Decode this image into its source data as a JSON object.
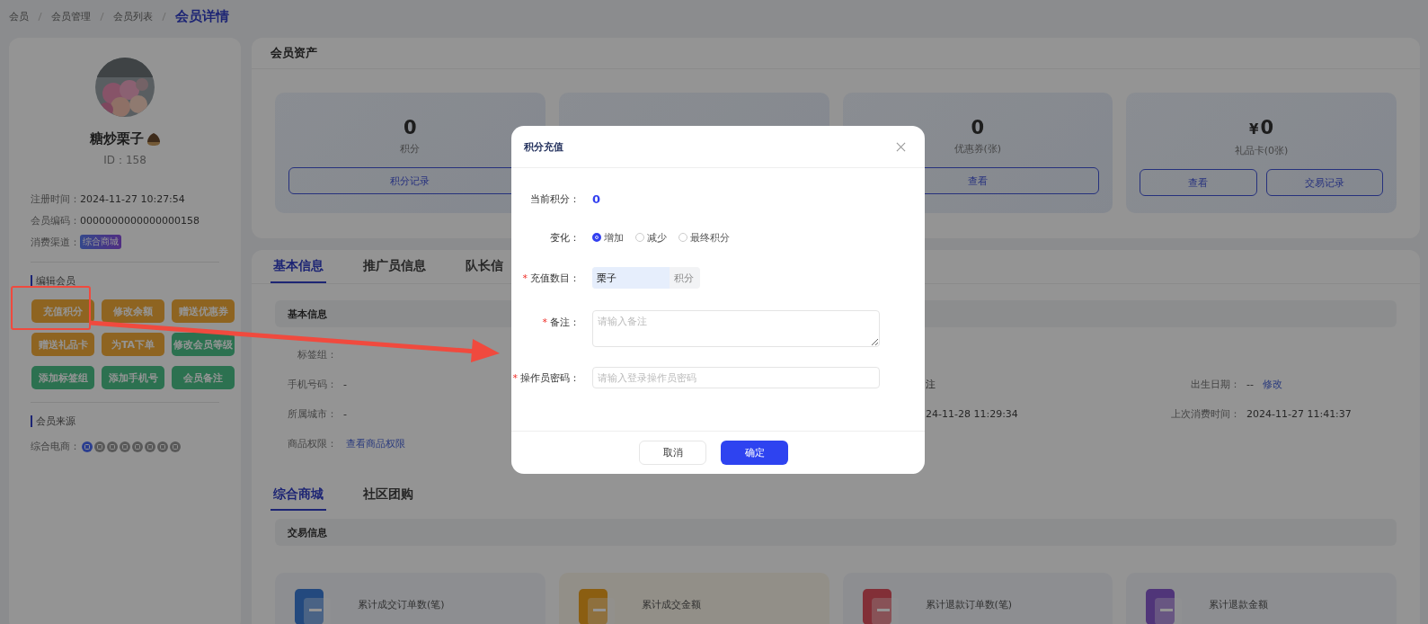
{
  "breadcrumb": [
    {
      "label": "会员",
      "selected": false
    },
    {
      "label": "会员管理",
      "selected": false
    },
    {
      "label": "会员列表",
      "selected": false
    },
    {
      "label": "会员详情",
      "selected": true
    }
  ],
  "profile": {
    "name": "糖炒栗子",
    "id_text": "ID：158",
    "info": [
      {
        "label": "注册时间：",
        "value": "2024-11-27 10:27:54"
      },
      {
        "label": "会员编码：",
        "value": "0000000000000000158"
      },
      {
        "label": "消费渠道：",
        "tag": "综合商城"
      }
    ]
  },
  "edit_section": {
    "title": "编辑会员",
    "buttons": [
      {
        "label": "充值积分",
        "kind": "warning"
      },
      {
        "label": "修改余额",
        "kind": "warning"
      },
      {
        "label": "赠送优惠券",
        "kind": "warning"
      },
      {
        "label": "赠送礼品卡",
        "kind": "warning"
      },
      {
        "label": "为TA下单",
        "kind": "warning"
      },
      {
        "label": "修改会员等级",
        "kind": "success"
      },
      {
        "label": "添加标签组",
        "kind": "success"
      },
      {
        "label": "添加手机号",
        "kind": "success"
      },
      {
        "label": "会员备注",
        "kind": "success"
      }
    ]
  },
  "source_section": {
    "title": "会员来源",
    "label": "综合电商：",
    "channels": [
      {
        "active": true
      },
      {
        "active": false
      },
      {
        "active": false
      },
      {
        "active": false
      },
      {
        "active": false
      },
      {
        "active": false
      },
      {
        "active": false
      },
      {
        "active": false
      }
    ]
  },
  "assets": {
    "title": "会员资产",
    "cards": [
      {
        "kind": "stat",
        "value": "0",
        "label": "积分",
        "buttons": [
          "积分记录"
        ]
      },
      {
        "kind": "covered"
      },
      {
        "kind": "stat",
        "value": "0",
        "label": "优惠券(张)",
        "buttons": [
          "查看"
        ]
      },
      {
        "kind": "stat",
        "currency": "¥",
        "value": "0",
        "label": "礼品卡(0张)",
        "buttons": [
          "查看",
          "交易记录"
        ]
      }
    ]
  },
  "info_tabs": [
    {
      "label": "基本信息",
      "selected": true
    },
    {
      "label": "推广员信息",
      "selected": false
    },
    {
      "label": "队长信",
      "selected": false
    }
  ],
  "basic_info": {
    "title": "基本信息",
    "rows": [
      {
        "left": {
          "label": "标签组："
        }
      },
      {
        "left": {
          "label": "手机号码：",
          "value": "-"
        },
        "middle": {
          "value": "注"
        },
        "right": {
          "label": "出生日期：",
          "value": "--",
          "link": "修改"
        }
      },
      {
        "left": {
          "label": "所属城市：",
          "value": "-"
        },
        "middle": {
          "value": "24-11-28 11:29:34"
        },
        "right": {
          "label": "上次消费时间：",
          "value": "2024-11-27 11:41:37"
        }
      },
      {
        "left": {
          "label": "商品权限：",
          "link": "查看商品权限"
        }
      }
    ]
  },
  "shop_tabs": [
    {
      "label": "综合商城",
      "selected": true
    },
    {
      "label": "社区团购",
      "selected": false
    }
  ],
  "trade": {
    "title": "交易信息",
    "stats": [
      {
        "label": "累计成交订单数(笔)",
        "kind": "orders"
      },
      {
        "label": "累计成交金额",
        "kind": "sales"
      },
      {
        "label": "累计退款订单数(笔)",
        "kind": "refund-orders"
      },
      {
        "label": "累计退款金额",
        "kind": "refunds"
      }
    ]
  },
  "dialog": {
    "title": "积分充值",
    "current_label": "当前积分：",
    "current_value": "0",
    "change_label": "变化：",
    "options": [
      {
        "label": "增加",
        "selected": true
      },
      {
        "label": "减少",
        "selected": false
      },
      {
        "label": "最终积分",
        "selected": false
      }
    ],
    "amount": {
      "label": "充值数目：",
      "required_mark": "*",
      "value": "栗子",
      "suffix": "积分"
    },
    "remark": {
      "label": "备注：",
      "required_mark": "*",
      "placeholder": "请输入备注"
    },
    "password": {
      "label": "操作员密码：",
      "required_mark": "*",
      "placeholder": "请输入登录操作员密码"
    },
    "cancel": "取消",
    "confirm": "确定"
  }
}
